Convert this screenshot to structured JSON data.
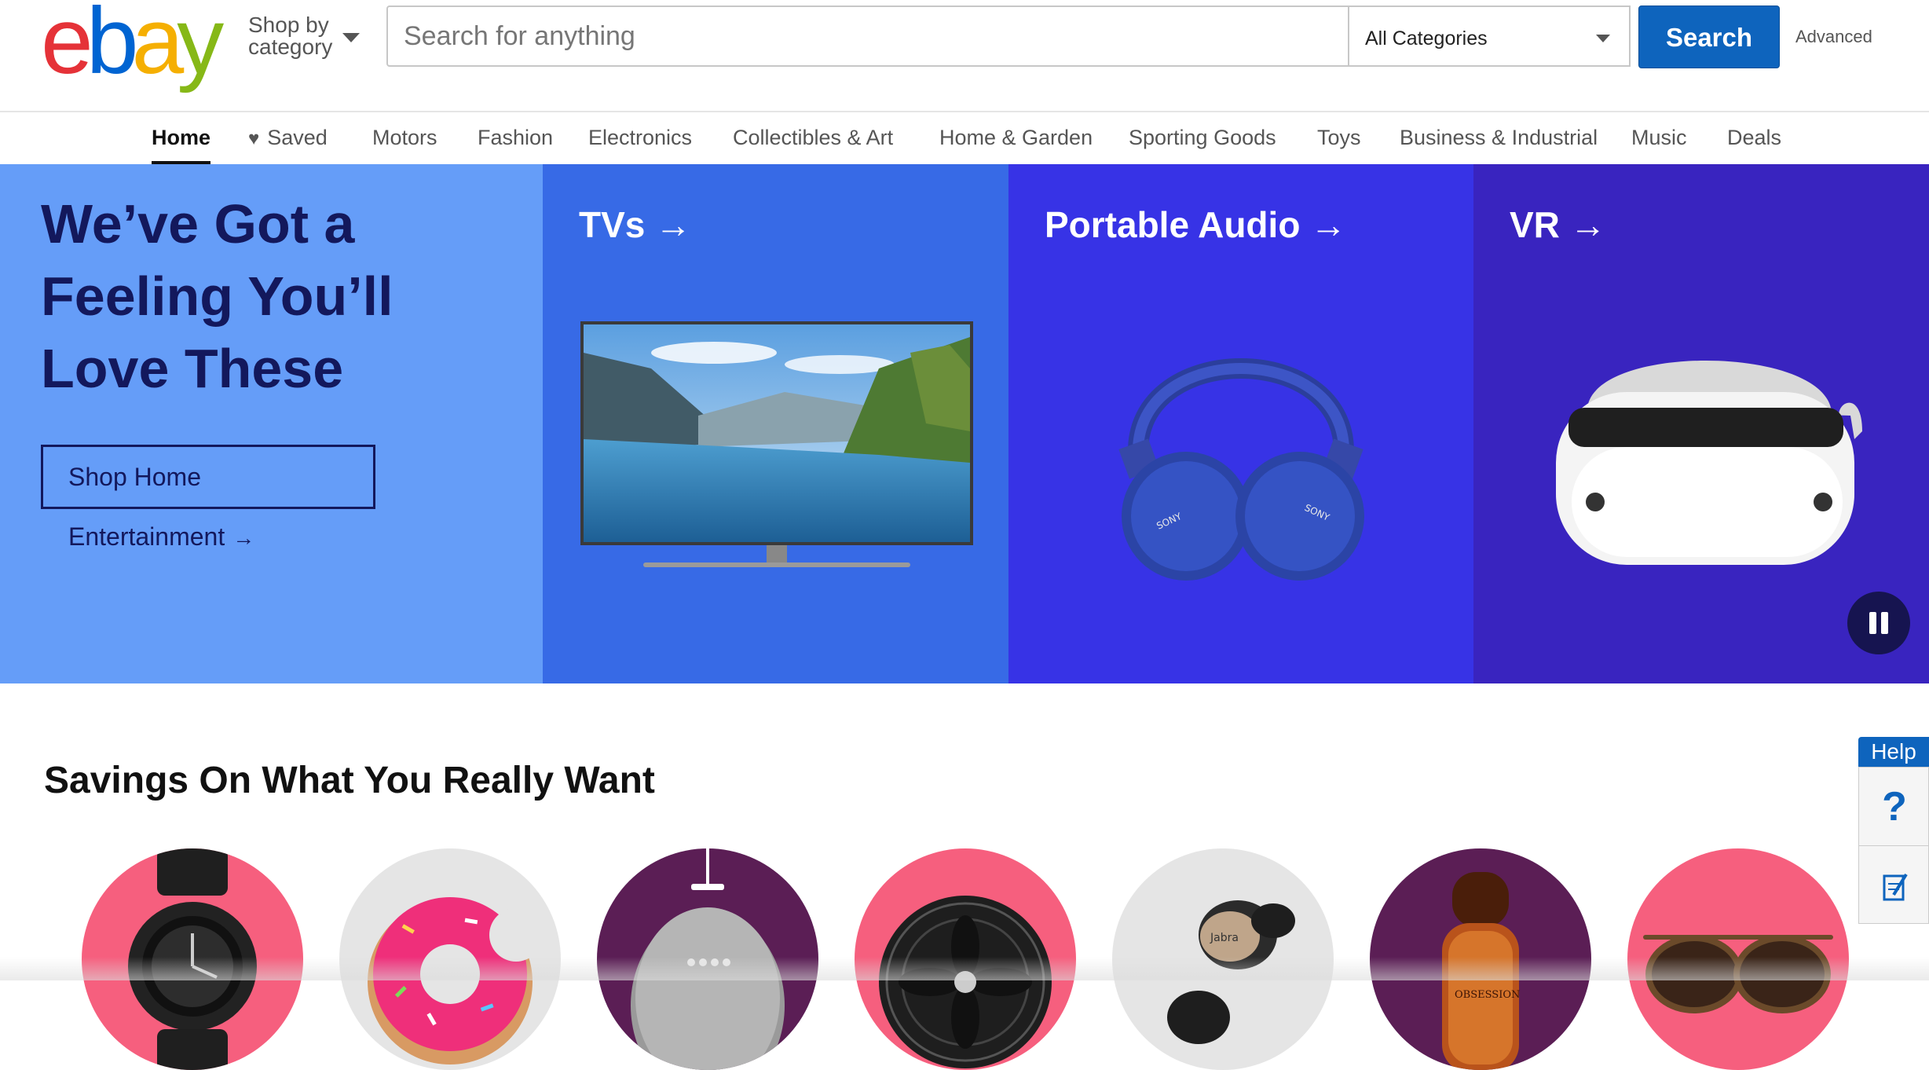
{
  "header": {
    "logo_letters": [
      "e",
      "b",
      "a",
      "y"
    ],
    "logo_colors": [
      "#e53238",
      "#0064d2",
      "#f5af02",
      "#86b817"
    ],
    "shop_by_category": "Shop by category",
    "search_placeholder": "Search for anything",
    "category_select": "All Categories",
    "search_button": "Search",
    "advanced_link": "Advanced"
  },
  "nav": {
    "items": [
      "Home",
      "Saved",
      "Motors",
      "Fashion",
      "Electronics",
      "Collectibles & Art",
      "Home & Garden",
      "Sporting Goods",
      "Toys",
      "Business & Industrial",
      "Music",
      "Deals"
    ],
    "active": "Home"
  },
  "hero": {
    "title": "We’ve Got a Feeling You’ll Love These",
    "cta": "Shop Home Entertainment",
    "panels": [
      {
        "title": "TVs",
        "image": "tv-image",
        "bg": "#376ae6"
      },
      {
        "title": "Portable Audio",
        "image": "headphones-image",
        "bg": "#3733e6"
      },
      {
        "title": "VR",
        "image": "vr-headset-image",
        "bg": "#3924bf"
      }
    ],
    "brand_label": "SONY"
  },
  "savings": {
    "title": "Savings On What You Really Want",
    "items": [
      {
        "image": "watch-image",
        "bg": "#f65f7e"
      },
      {
        "image": "donut-float-image",
        "bg": "#e5e5e5"
      },
      {
        "image": "smart-speaker-image",
        "bg": "#5b1e55"
      },
      {
        "image": "fan-image",
        "bg": "#f65f7e"
      },
      {
        "image": "earbuds-image",
        "bg": "#e5e5e5"
      },
      {
        "image": "perfume-image",
        "bg": "#5b1e55"
      },
      {
        "image": "sunglasses-image",
        "bg": "#f65f7e"
      }
    ],
    "earbud_label": "Jabra",
    "perfume_label": "OBSESSION"
  },
  "help": {
    "label": "Help",
    "question": "?"
  }
}
